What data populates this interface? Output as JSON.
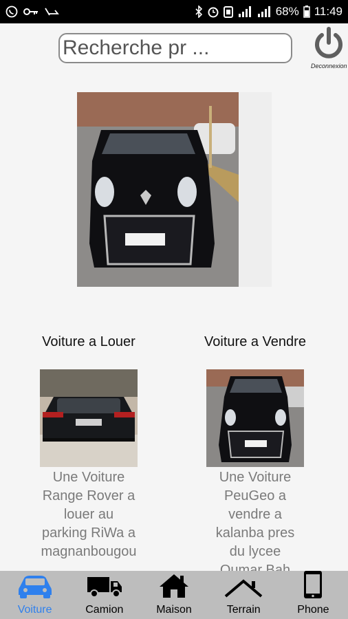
{
  "statusbar": {
    "battery": "68%",
    "time": "11:49"
  },
  "search": {
    "placeholder": "Recherche pr ..."
  },
  "logout": {
    "label": "Deconnexion"
  },
  "sections": [
    {
      "title": "Voiture a Louer",
      "description": "Une Voiture Range Rover a louer au parking RiWa a magnanbougou"
    },
    {
      "title": "Voiture a Vendre",
      "description": "Une Voiture PeuGeo a vendre a kalanba pres du lycee Oumar Bah"
    }
  ],
  "nav": [
    {
      "label": "Voiture",
      "icon": "car-icon",
      "active": true
    },
    {
      "label": "Camion",
      "icon": "truck-icon",
      "active": false
    },
    {
      "label": "Maison",
      "icon": "house-icon",
      "active": false
    },
    {
      "label": "Terrain",
      "icon": "roof-icon",
      "active": false
    },
    {
      "label": "Phone",
      "icon": "phone-icon",
      "active": false
    }
  ],
  "colors": {
    "active": "#2f80ed",
    "navbar": "#bdbdbd"
  }
}
